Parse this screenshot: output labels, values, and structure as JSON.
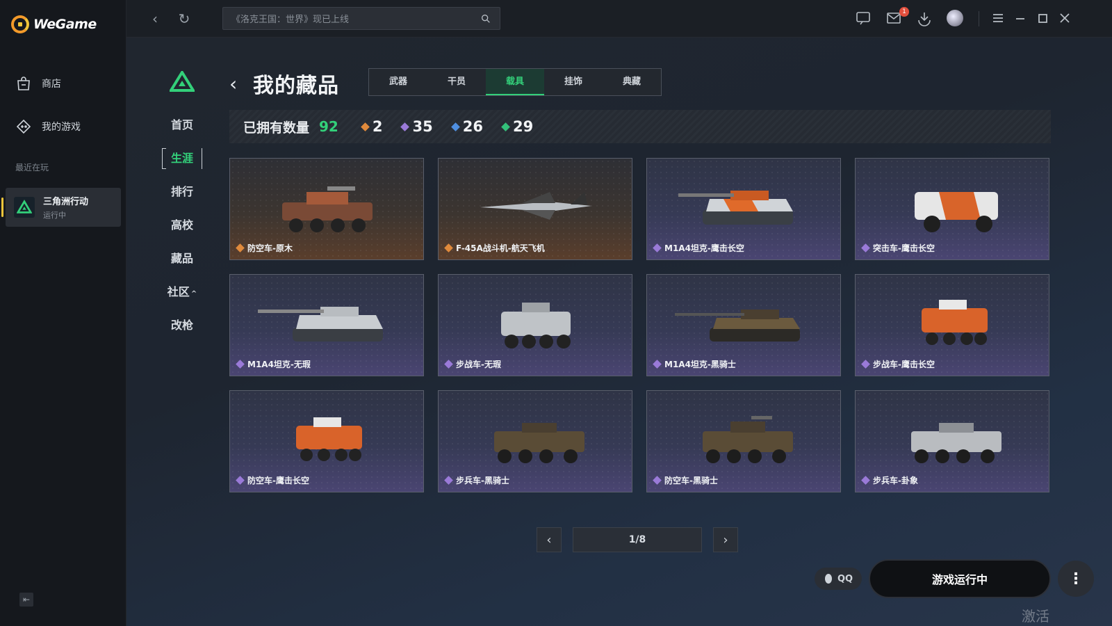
{
  "app": {
    "name": "WeGame"
  },
  "sidebar": {
    "items": [
      {
        "label": "商店",
        "icon": "shop-bag-icon"
      },
      {
        "label": "我的游戏",
        "icon": "game-controller-icon"
      }
    ],
    "recent_label": "最近在玩",
    "recent_game": {
      "title": "三角洲行动",
      "status": "运行中"
    }
  },
  "topbar": {
    "search_placeholder": "《洛克王国：世界》现已上线",
    "mail_badge": "1"
  },
  "subnav": {
    "items": [
      {
        "label": "首页"
      },
      {
        "label": "生涯"
      },
      {
        "label": "排行"
      },
      {
        "label": "高校"
      },
      {
        "label": "藏品"
      },
      {
        "label": "社区"
      },
      {
        "label": "改枪"
      }
    ],
    "active_index": 1
  },
  "page": {
    "title": "我的藏品",
    "tabs": [
      "武器",
      "干员",
      "载具",
      "挂饰",
      "典藏"
    ],
    "active_tab": 2
  },
  "summary": {
    "owned_label": "已拥有数量",
    "owned_total": "92",
    "stats": [
      {
        "value": "2",
        "color": "#e08a3c"
      },
      {
        "value": "35",
        "color": "#9a7ad8"
      },
      {
        "value": "26",
        "color": "#4f8fe0"
      },
      {
        "value": "29",
        "color": "#33c07a"
      }
    ]
  },
  "cards": [
    {
      "name": "防空车-原木",
      "rarity": "orange"
    },
    {
      "name": "F-45A战斗机-航天飞机",
      "rarity": "orange"
    },
    {
      "name": "M1A4坦克-鹰击长空",
      "rarity": "purple"
    },
    {
      "name": "突击车-鹰击长空",
      "rarity": "purple"
    },
    {
      "name": "M1A4坦克-无瑕",
      "rarity": "purple"
    },
    {
      "name": "步战车-无瑕",
      "rarity": "purple"
    },
    {
      "name": "M1A4坦克-黑骑士",
      "rarity": "purple"
    },
    {
      "name": "步战车-鹰击长空",
      "rarity": "purple"
    },
    {
      "name": "防空车-鹰击长空",
      "rarity": "purple"
    },
    {
      "name": "步兵车-黑骑士",
      "rarity": "purple"
    },
    {
      "name": "防空车-黑骑士",
      "rarity": "purple"
    },
    {
      "name": "步兵车-卦象",
      "rarity": "purple"
    }
  ],
  "pager": {
    "page_text": "1/8"
  },
  "footer": {
    "qq_label": "QQ",
    "run_label": "游戏运行中",
    "watermark": "激活 Windows"
  },
  "colors": {
    "accent_green": "#33d07a",
    "rarity_orange": "#e08a3c",
    "rarity_purple": "#9a7ad8"
  }
}
